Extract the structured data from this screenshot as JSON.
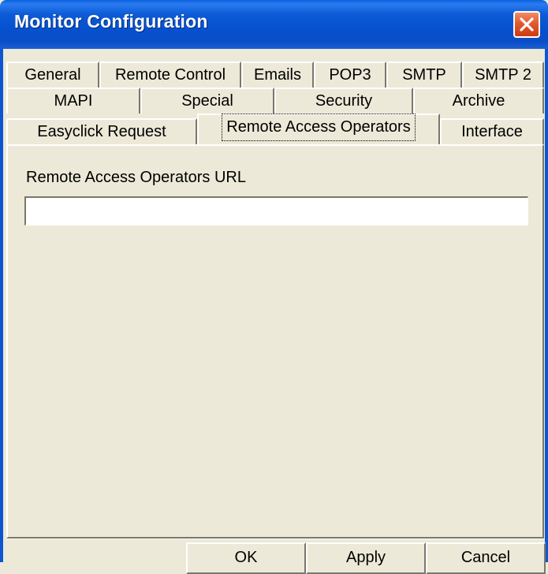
{
  "window": {
    "title": "Monitor Configuration"
  },
  "tabs": {
    "row1": [
      "General",
      "Remote Control",
      "Emails",
      "POP3",
      "SMTP",
      "SMTP 2"
    ],
    "row2": [
      "MAPI",
      "Special",
      "Security",
      "Archive"
    ],
    "row3": [
      "Easyclick Request",
      "Remote Access Operators",
      "Interface"
    ],
    "selected": "Remote Access Operators"
  },
  "form": {
    "url_label": "Remote Access Operators URL",
    "url_value": "",
    "url_placeholder": ""
  },
  "buttons": {
    "ok": "OK",
    "apply": "Apply",
    "cancel": "Cancel"
  },
  "colors": {
    "titlebar": "#0a52d1",
    "dialog": "#ece9d8",
    "close": "#e35a2f"
  },
  "icons": {
    "close": "close-icon"
  }
}
